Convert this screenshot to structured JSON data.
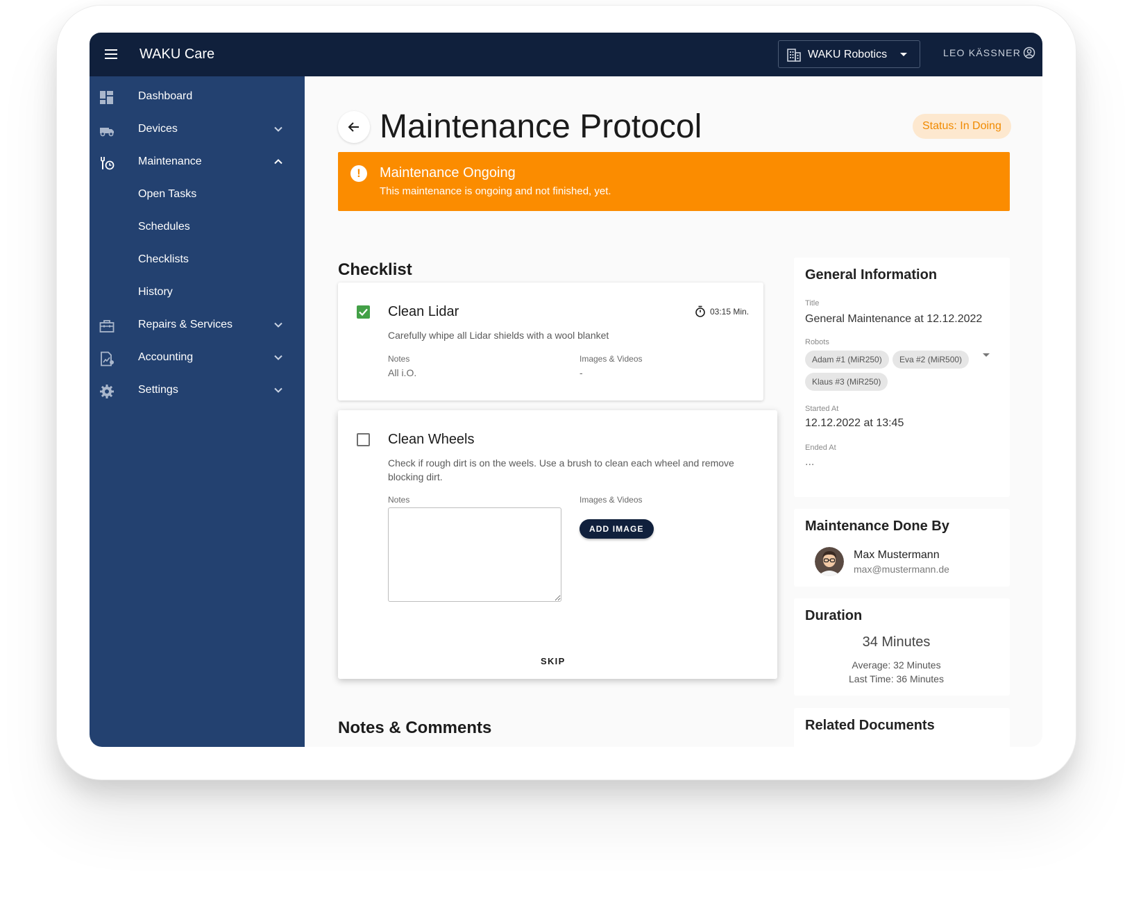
{
  "app": {
    "title": "WAKU Care"
  },
  "org_selector": {
    "label": "WAKU Robotics"
  },
  "user": {
    "name": "LEO KÄSSNER"
  },
  "sidebar": {
    "items": [
      {
        "label": "Dashboard",
        "icon": "dashboard-icon"
      },
      {
        "label": "Devices",
        "icon": "truck-icon",
        "expandable": true,
        "expanded": false
      },
      {
        "label": "Maintenance",
        "icon": "maintenance-icon",
        "expandable": true,
        "expanded": true
      },
      {
        "label": "Open Tasks",
        "sub": true
      },
      {
        "label": "Schedules",
        "sub": true
      },
      {
        "label": "Checklists",
        "sub": true
      },
      {
        "label": "History",
        "sub": true
      },
      {
        "label": "Repairs & Services",
        "icon": "toolbox-icon",
        "expandable": true,
        "expanded": false
      },
      {
        "label": "Accounting",
        "icon": "accounting-icon",
        "expandable": true,
        "expanded": false
      },
      {
        "label": "Settings",
        "icon": "gear-icon",
        "expandable": true,
        "expanded": false
      }
    ]
  },
  "page": {
    "title": "Maintenance Protocol",
    "status": "Status: In Doing",
    "status_color": "#f08a00"
  },
  "alert": {
    "title": "Maintenance Ongoing",
    "message": "This maintenance is ongoing and not finished, yet.",
    "color": "#fb8c00"
  },
  "checklist": {
    "heading": "Checklist",
    "tasks": [
      {
        "title": "Clean Lidar",
        "checked": true,
        "time": "03:15 Min.",
        "description": "Carefully whipe all Lidar shields with a wool blanket",
        "notes_label": "Notes",
        "notes": "All i.O.",
        "media_label": "Images & Videos",
        "media": "-"
      },
      {
        "title": "Clean Wheels",
        "checked": false,
        "description": "Check if rough dirt is on the weels. Use a brush to clean each wheel and remove blocking dirt.",
        "notes_label": "Notes",
        "notes_value": "",
        "media_label": "Images & Videos",
        "add_image_label": "ADD IMAGE",
        "skip_label": "SKIP"
      }
    ]
  },
  "notes_section": {
    "heading": "Notes & Comments"
  },
  "general_info": {
    "heading": "General Information",
    "title_label": "Title",
    "title_value": "General Maintenance at 12.12.2022",
    "robots_label": "Robots",
    "robots": [
      "Adam #1 (MiR250)",
      "Eva #2 (MiR500)",
      "Klaus #3 (MiR250)"
    ],
    "started_label": "Started At",
    "started_value": "12.12.2022 at 13:45",
    "ended_label": "Ended At",
    "ended_value": "..."
  },
  "done_by": {
    "heading": "Maintenance Done By",
    "name": "Max Mustermann",
    "email": "max@mustermann.de"
  },
  "duration": {
    "heading": "Duration",
    "value": "34 Minutes",
    "average": "Average: 32 Minutes",
    "last_time": "Last Time: 36 Minutes"
  },
  "related_docs": {
    "heading": "Related Documents"
  }
}
